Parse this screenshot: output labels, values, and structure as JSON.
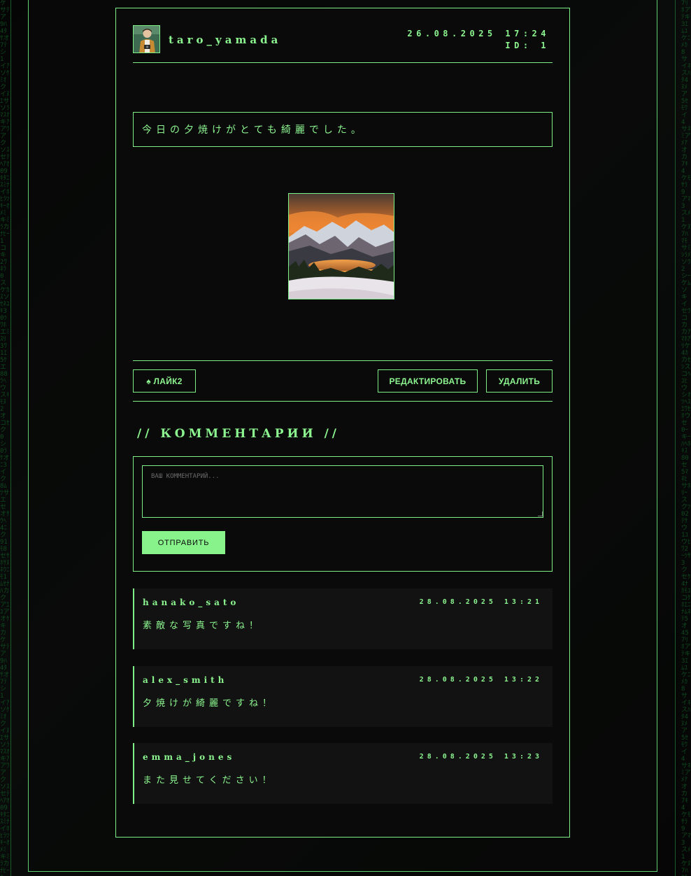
{
  "post": {
    "author": "taro_yamada",
    "date": "26.08.2025 17:24",
    "id_label": "ID: 1",
    "text": "今日の夕焼けがとても綺麗でした。"
  },
  "actions": {
    "like_label": "♠ ЛАЙК2",
    "like_count": 2,
    "edit_label": "РЕДАКТИРОВАТЬ",
    "delete_label": "УДАЛИТЬ"
  },
  "comments_section": {
    "title": "// КОММЕНТАРИИ //",
    "input_placeholder": "ВАШ КОММЕНТАРИЙ...",
    "submit_label": "ОТПРАВИТЬ",
    "items": [
      {
        "author": "hanako_sato",
        "date": "28.08.2025 13:21",
        "text": "素敵な写真ですね！"
      },
      {
        "author": "alex_smith",
        "date": "28.08.2025 13:22",
        "text": "夕焼けが綺麗ですね！"
      },
      {
        "author": "emma_jones",
        "date": "28.08.2025 13:23",
        "text": "また見せてください！"
      }
    ]
  },
  "colors": {
    "accent": "#7ef087",
    "background": "#0a0a0a",
    "button_fill": "#88f38b",
    "comment_bg": "#111211"
  }
}
